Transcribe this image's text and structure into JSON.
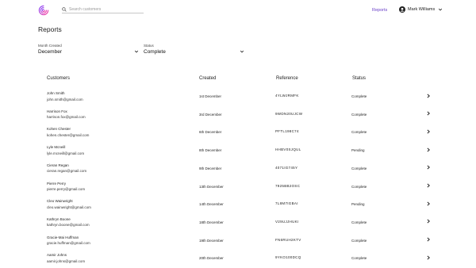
{
  "header": {
    "logo_icon": "spiral-logo-icon",
    "search_placeholder": "Search customers",
    "nav_reports": "Reports",
    "user_name": "Mark Williams"
  },
  "page_title": "Reports",
  "filters": {
    "month": {
      "label": "Month Created",
      "value": "December"
    },
    "status": {
      "label": "Status",
      "value": "Complete"
    }
  },
  "table": {
    "headers": [
      "Customers",
      "Created",
      "Reference",
      "Status"
    ],
    "rows": [
      {
        "name": "John Smith",
        "email": "john.smith@gmail.com",
        "created": "1st December",
        "ref": "4YLWJRMFK",
        "status": "Complete"
      },
      {
        "name": "Harrison Fox",
        "email": "harrison.fox@gmail.com",
        "created": "3rd December",
        "ref": "9WDN20UJCW",
        "status": "Complete"
      },
      {
        "name": "Kohen Chester",
        "email": "kohen.chester@gmail.com",
        "created": "6th December",
        "ref": "PFTL198C74",
        "status": "Complete"
      },
      {
        "name": "Lyle Mcneill",
        "email": "lyle.mcneill@gmail.com",
        "created": "8th December",
        "ref": "HHBV0SJQUL",
        "status": "Pending"
      },
      {
        "name": "Cieran Regan",
        "email": "cieran.regan@gmail.com",
        "created": "9th December",
        "ref": "4071IG745Y",
        "status": "Complete"
      },
      {
        "name": "Pierre Perry",
        "email": "pierre.perry@gmail.com",
        "created": "13th December",
        "ref": "7925BB2OSC",
        "status": "Complete"
      },
      {
        "name": "Cleo Wainwright",
        "email": "cleo.wainwright@gmail.com",
        "created": "14th December",
        "ref": "7L8M7IGBAI",
        "status": "Pending"
      },
      {
        "name": "Kathryn Boone",
        "email": "kathryn.boone@gmail.com",
        "created": "18th December",
        "ref": "V29UJJHUKI",
        "status": "Complete"
      },
      {
        "name": "Gracie-Mai Huffman",
        "email": "gracie.huffman@gmail.com",
        "created": "19th December",
        "ref": "FN6RUH2KTV",
        "status": "Complete"
      },
      {
        "name": "Aamir Johns",
        "email": "aamir.johns@gmail.com",
        "created": "20th December",
        "ref": "9YKO100DCQ",
        "status": "Complete"
      }
    ]
  },
  "colors": {
    "accent": "#6a3fc8",
    "logo_gradient": [
      "#7a3cff",
      "#ff3c9a"
    ]
  }
}
